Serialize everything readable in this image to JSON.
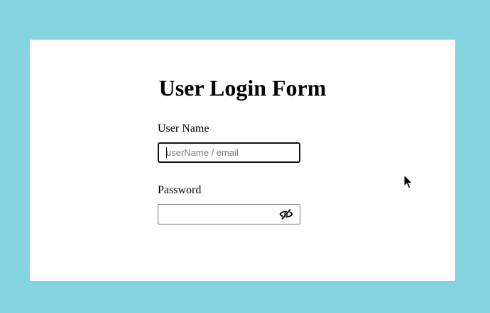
{
  "form": {
    "title": "User Login Form",
    "username": {
      "label": "User Name",
      "placeholder": "userName / email",
      "value": ""
    },
    "password": {
      "label": "Password",
      "value": "",
      "toggle_icon": "eye-slash-icon"
    }
  },
  "colors": {
    "page_background": "#86d3e0",
    "card_background": "#ffffff",
    "focused_input_border": "#111111"
  }
}
